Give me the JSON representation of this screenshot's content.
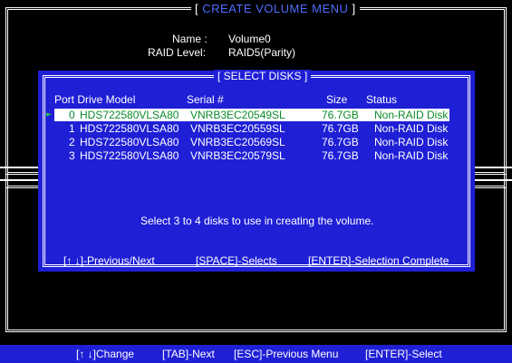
{
  "window": {
    "title_prefix": "[ ",
    "title": "CREATE VOLUME MENU",
    "title_suffix": " ]"
  },
  "volume": {
    "name_label": "Name :",
    "name_value": "Volume0",
    "raid_label": "RAID Level:",
    "raid_value": "RAID5(Parity)"
  },
  "dialog": {
    "title": "[ SELECT DISKS ]",
    "columns": {
      "port_model": "Port Drive Model",
      "serial": "Serial #",
      "size": "Size",
      "status": "Status"
    },
    "disks": [
      {
        "port": "0",
        "model": "HDS722580VLSA80",
        "serial": "VNRB3EC20549SL",
        "size": "76.7GB",
        "status": "Non-RAID Disk"
      },
      {
        "port": "1",
        "model": "HDS722580VLSA80",
        "serial": "VNRB3EC20559SL",
        "size": "76.7GB",
        "status": "Non-RAID Disk"
      },
      {
        "port": "2",
        "model": "HDS722580VLSA80",
        "serial": "VNRB3EC20569SL",
        "size": "76.7GB",
        "status": "Non-RAID Disk"
      },
      {
        "port": "3",
        "model": "HDS722580VLSA80",
        "serial": "VNRB3EC20579SL",
        "size": "76.7GB",
        "status": "Non-RAID Disk"
      }
    ],
    "instruction": "Select 3 to 4 disks to use in creating the volume.",
    "keys": {
      "navigate": "[↑ ↓]-Previous/Next",
      "space": "[SPACE]-Selects",
      "enter": "[ENTER]-Selection Complete"
    }
  },
  "bottom_bar": {
    "change": "[↑ ↓]Change",
    "tab": "[TAB]-Next",
    "esc": "[ESC]-Previous Menu",
    "enter": "[ENTER]-Select"
  },
  "colors": {
    "background": "#000000",
    "panel_blue": "#1f1fd6",
    "selected_text": "#0a8a2a",
    "title_accent": "#4f6dff"
  }
}
